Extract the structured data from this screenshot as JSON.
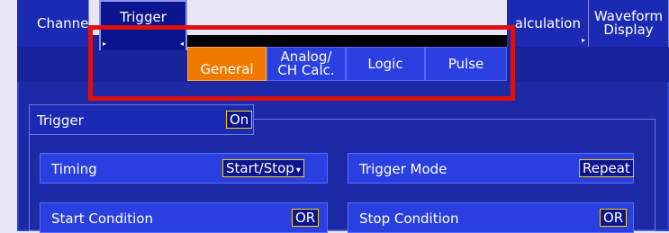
{
  "tabs": [
    {
      "label": "Channe"
    },
    {
      "label": "Trigger"
    },
    {
      "label": "alculation"
    },
    {
      "label": "Waveform\nDisplay"
    }
  ],
  "subtabs": [
    {
      "label": "General"
    },
    {
      "label": "Analog/\nCH Calc."
    },
    {
      "label": "Logic"
    },
    {
      "label": "Pulse"
    }
  ],
  "trigger": {
    "label": "Trigger",
    "value": "On"
  },
  "timing": {
    "label": "Timing",
    "value": "Start/Stop"
  },
  "trigger_mode": {
    "label": "Trigger Mode",
    "value": "Repeat"
  },
  "start_condition": {
    "label": "Start Condition",
    "value": "OR"
  },
  "stop_condition": {
    "label": "Stop Condition",
    "value": "OR"
  },
  "colors": {
    "background": "#1d2aa6",
    "tab_active": "#f07a00",
    "highlight": "#e01010",
    "value_border": "#ffd000"
  }
}
